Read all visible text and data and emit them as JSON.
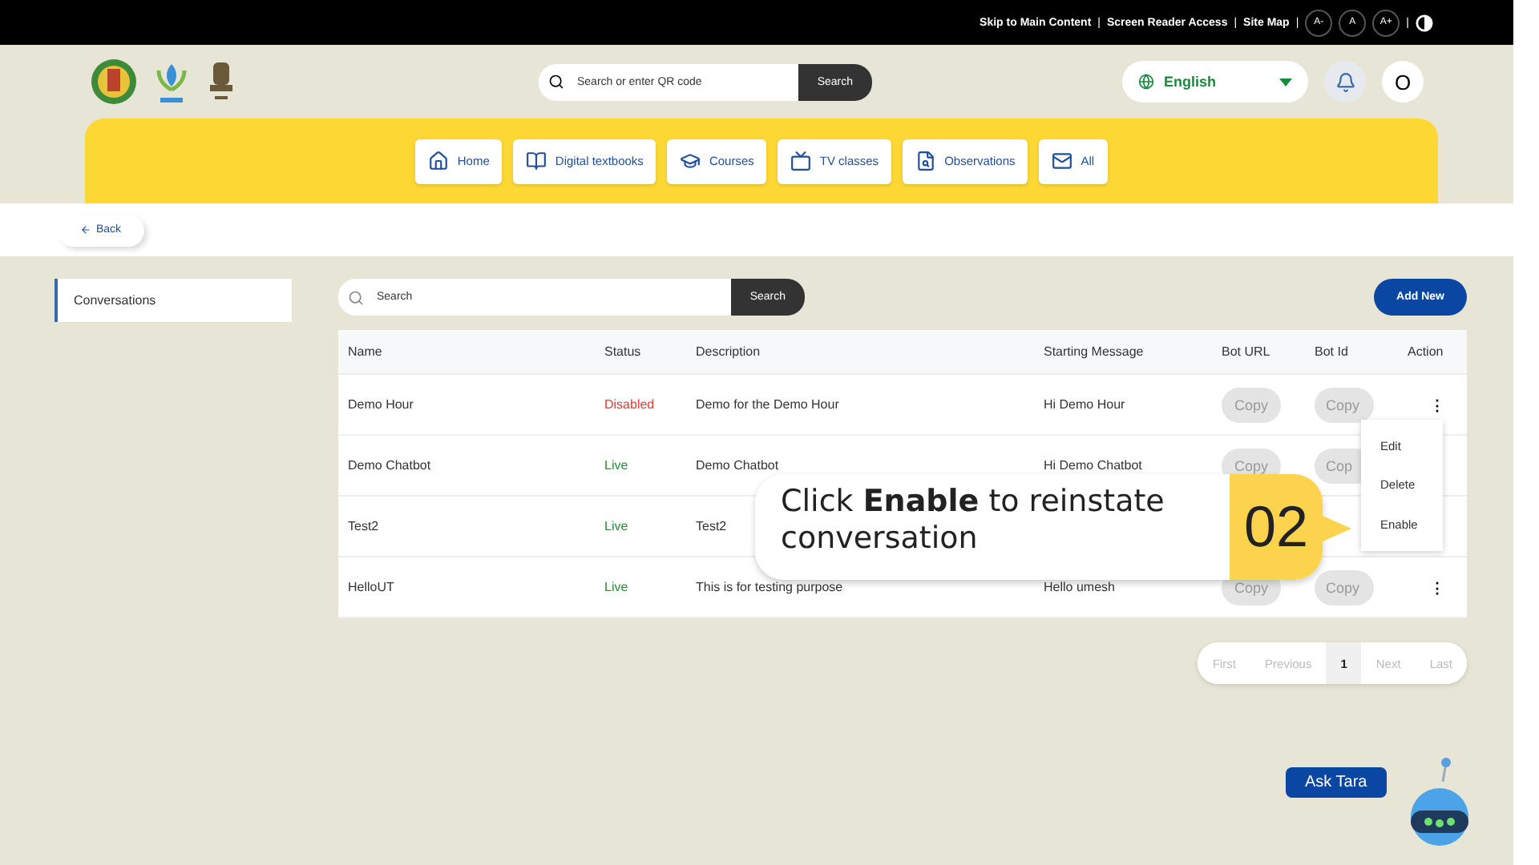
{
  "top_bar": {
    "links": [
      "Skip to Main Content",
      "Screen Reader Access",
      "Site Map"
    ],
    "separator": "|",
    "font_buttons": [
      "A-",
      "A",
      "A+"
    ]
  },
  "header": {
    "search": {
      "placeholder": "Search or enter QR code",
      "button": "Search"
    },
    "language": "English",
    "avatar": "O"
  },
  "nav": [
    "Home",
    "Digital textbooks",
    "Courses",
    "TV classes",
    "Observations",
    "All"
  ],
  "back": "Back",
  "sidebar": {
    "items": [
      {
        "label": "Conversations",
        "selected": true
      }
    ]
  },
  "search": {
    "placeholder": "Search",
    "button": "Search"
  },
  "add_new": "Add New",
  "table": {
    "columns": [
      "Name",
      "Status",
      "Description",
      "Starting Message",
      "Bot URL",
      "Bot Id",
      "Action"
    ],
    "rows": [
      {
        "name": "Demo Hour",
        "status": "Disabled",
        "live": false,
        "description": "Demo for the Demo Hour",
        "starting_message": "Hi Demo Hour",
        "bot_url": "Copy",
        "bot_id": "Copy",
        "action": "⋮"
      },
      {
        "name": "Demo Chatbot",
        "status": "Live",
        "live": true,
        "description": "Demo Chatbot",
        "starting_message": "Hi Demo Chatbot",
        "bot_url": "Copy",
        "bot_id": "Cop"
      },
      {
        "name": "Test2",
        "status": "Live",
        "live": true,
        "description": "Test2"
      },
      {
        "name": "HelloUT",
        "status": "Live",
        "live": true,
        "description": "This is for testing purpose",
        "starting_message": "Hello umesh",
        "bot_url": "Copy",
        "bot_id": "Copy",
        "action": "⋮"
      }
    ]
  },
  "action_menu": [
    "Edit",
    "Delete",
    "Enable"
  ],
  "pagination": [
    {
      "label": "First",
      "selected": false
    },
    {
      "label": "Previous",
      "selected": false
    },
    {
      "label": "1",
      "selected": true
    },
    {
      "label": "Next",
      "selected": false
    },
    {
      "label": "Last",
      "selected": false
    }
  ],
  "callout": {
    "text": "Click **Enable** to reinstate conversation",
    "step": "02"
  },
  "chat_button": "Ask Tara"
}
